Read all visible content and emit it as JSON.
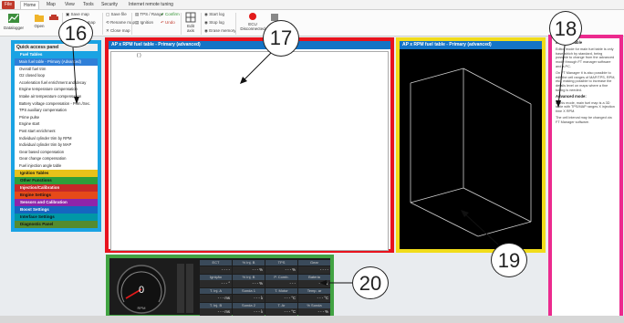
{
  "ribbon": {
    "tabs": [
      "File",
      "Home",
      "Map",
      "View",
      "Tools",
      "Security",
      "Internet remote tuning"
    ],
    "groups": {
      "datalogger": "Datalogger",
      "open": "Open",
      "vehicles": "Vehicles",
      "save_map": "Save map",
      "rename_map": "Rename map",
      "close_map": "Close map",
      "tps_range": "TPS / Range",
      "confirm": "Confirm",
      "undo": "Undo",
      "ignition": "Ignition",
      "edit_axis": "Edit axis",
      "start_log": "Start log",
      "stop_log": "Stop log",
      "erase_memory": "Erase memory",
      "ecu_status": "ECU\nDisconnected"
    }
  },
  "quick_access": {
    "title": "Quick access panel",
    "categories": [
      {
        "label": "Fuel Tables",
        "color": "#1aa3e3"
      },
      {
        "label": "Ignition Tables",
        "color": "#e8c21a"
      },
      {
        "label": "Other Functions",
        "color": "#2f9e3a"
      },
      {
        "label": "Injection/Calibration",
        "color": "#c62828"
      },
      {
        "label": "Engine Settings",
        "color": "#e64a19"
      },
      {
        "label": "Sensors and Calibration",
        "color": "#8e24aa"
      },
      {
        "label": "Boost Settings",
        "color": "#1565c0"
      },
      {
        "label": "Interface Settings",
        "color": "#0097a7"
      },
      {
        "label": "Diagnostic Panel",
        "color": "#558b2f"
      }
    ],
    "items": [
      "Main fuel table - Primary (Advanced)",
      "Overall fuel trim",
      "O2 closed loop",
      "Acceleration fuel enrichment and decay",
      "Engine temperature compensation",
      "Intake air temperature compensation",
      "Battery voltage compensation - Prim./Sec.",
      "TPS auxiliary compensation",
      "Prime pulse",
      "Engine start",
      "Post start enrichment",
      "Individual cylinder trim by RPM",
      "Individual cylinder trim by MAP",
      "Gear based compensation",
      "Gear change compensation",
      "Fuel injection angle table"
    ]
  },
  "editor": {
    "title": "AP x RPM fuel table - Primary (advanced)",
    "content": "( )"
  },
  "view3d": {
    "title": "AP x RPM fuel table - Primary (advanced)"
  },
  "help": {
    "title": "Main fuel table",
    "paragraphs": [
      "Main fuel table",
      "Editor mode for main fuel table is only base which by standard, being possible to change from the advanced mode through FT manager software and a PC.",
      "On FT Manager it is also possible to edit the cell ranges of MAP/TPS, RPM, etc., making possible to increase the details level on maps where a fine tuning is needed.",
      "Advanced mode:",
      "In this mode, main fuel map is a 3D table with TPS/MAP ranges X injection time X RPM.",
      "The cell interval may be changed via FT Manager software."
    ]
  },
  "dashboard": {
    "gauge_value": "0",
    "gauge_unit": "RPM",
    "gauge_max": "x1000",
    "headers": [
      "ECT",
      "% Inj. B",
      "TPS",
      "Gear",
      "Ignição",
      "% Inj. B",
      "P. Comb.",
      "Bateria",
      "T. Inj. A",
      "Sonda 1",
      "T. Motor",
      "Temp. ar",
      "T. Inj. B",
      "Sonda 2",
      "T. Ar",
      "% Sonda"
    ],
    "values": [
      "- - - -",
      "- - - %",
      "- - - %",
      "- - - -",
      "- - - °",
      "- - - %",
      "- - - ",
      "- - - V",
      "- - - ms",
      "- - - λ",
      "- - - °C",
      "- - - °C",
      "- - - ms",
      "- - - λ",
      "- - - °C",
      "- - - %"
    ]
  },
  "callouts": [
    "16",
    "17",
    "18",
    "19",
    "20"
  ]
}
